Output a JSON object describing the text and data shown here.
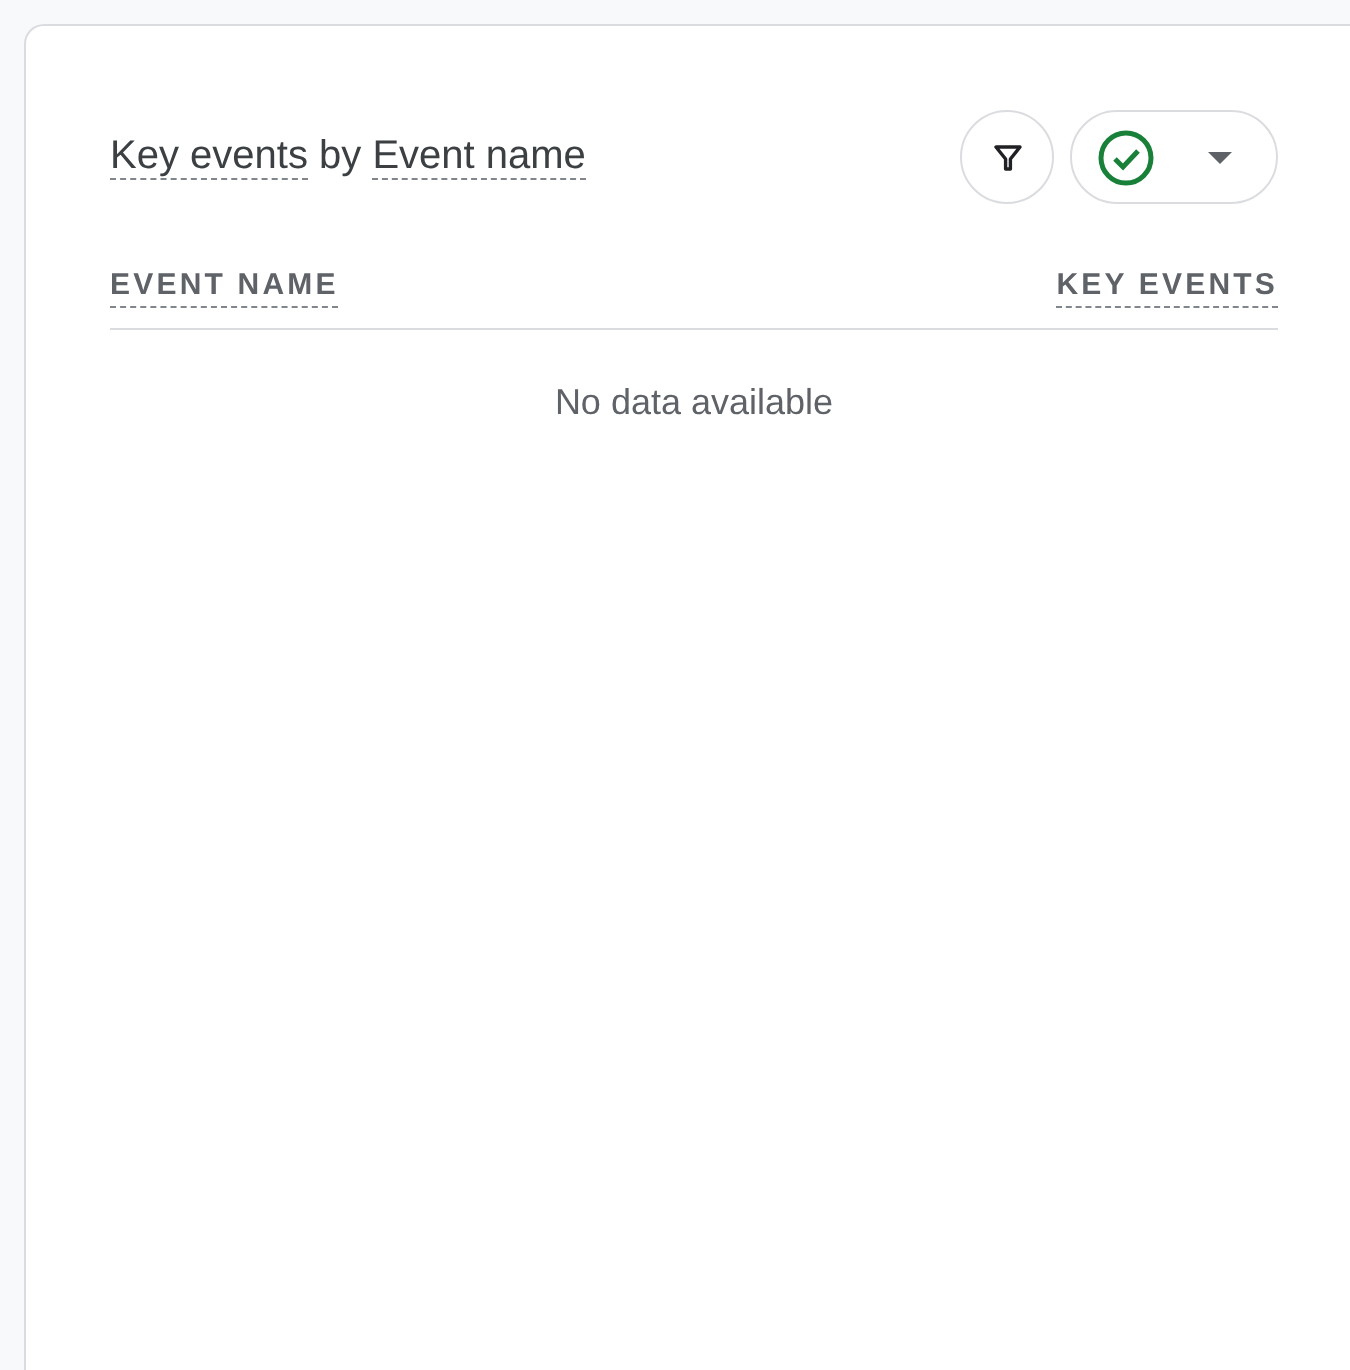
{
  "card": {
    "title_parts": [
      {
        "text": "Key events",
        "underlined": true
      },
      {
        "text": " by ",
        "underlined": false
      },
      {
        "text": "Event name",
        "underlined": true
      }
    ],
    "table": {
      "columns": [
        {
          "label": "EVENT NAME"
        },
        {
          "label": "KEY EVENTS"
        }
      ],
      "empty_message": "No data available"
    }
  }
}
